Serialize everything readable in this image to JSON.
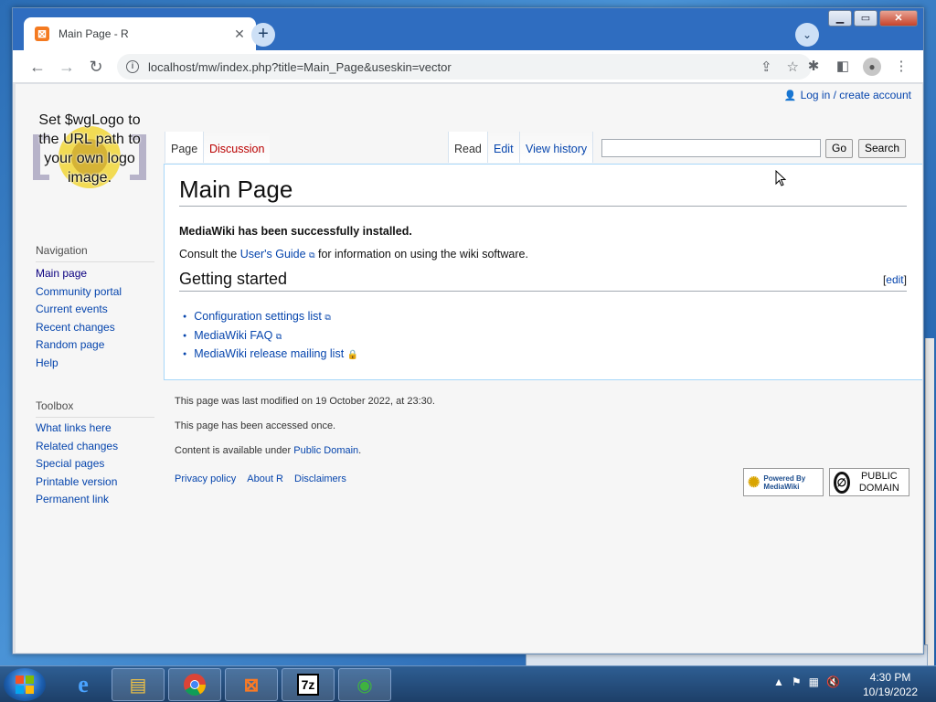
{
  "browser": {
    "tab_title": "Main Page - R",
    "tab_favicon": "xampp-icon",
    "url": "localhost/mw/index.php?title=Main_Page&useskin=vector",
    "window_controls": {
      "minimize": "▁",
      "maximize": "▭",
      "close": "✕"
    }
  },
  "wiki": {
    "personal_link": "Log in / create account",
    "logo_text": "Set $wgLogo to the URL path to your own logo image.",
    "tabs": {
      "page": "Page",
      "discussion": "Discussion",
      "read": "Read",
      "edit": "Edit",
      "history": "View history"
    },
    "search": {
      "go": "Go",
      "search": "Search",
      "value": ""
    },
    "navigation": {
      "heading": "Navigation",
      "items": [
        "Main page",
        "Community portal",
        "Current events",
        "Recent changes",
        "Random page",
        "Help"
      ]
    },
    "toolbox": {
      "heading": "Toolbox",
      "items": [
        "What links here",
        "Related changes",
        "Special pages",
        "Printable version",
        "Permanent link"
      ]
    },
    "content": {
      "title": "Main Page",
      "installed": "MediaWiki has been successfully installed.",
      "consult_prefix": "Consult the ",
      "users_guide": "User's Guide",
      "consult_suffix": " for information on using the wiki software.",
      "section_heading": "Getting started",
      "edit_label": "edit",
      "links": [
        "Configuration settings list",
        "MediaWiki FAQ",
        "MediaWiki release mailing list"
      ]
    },
    "footer": {
      "last_modified": "This page was last modified on 19 October 2022, at 23:30.",
      "accessed": "This page has been accessed once.",
      "content_prefix": "Content is available under ",
      "content_link": "Public Domain",
      "content_suffix": ".",
      "links": [
        "Privacy policy",
        "About R",
        "Disclaimers"
      ],
      "badge_mediawiki": "Powered By MediaWiki",
      "badge_public_domain": "PUBLIC DOMAIN"
    }
  },
  "taskbar": {
    "apps": [
      "internet-explorer-icon",
      "file-explorer-icon",
      "chrome-icon",
      "xampp-icon",
      "7zip-icon",
      "download-manager-icon"
    ],
    "clock_time": "4:30 PM",
    "clock_date": "10/19/2022"
  }
}
